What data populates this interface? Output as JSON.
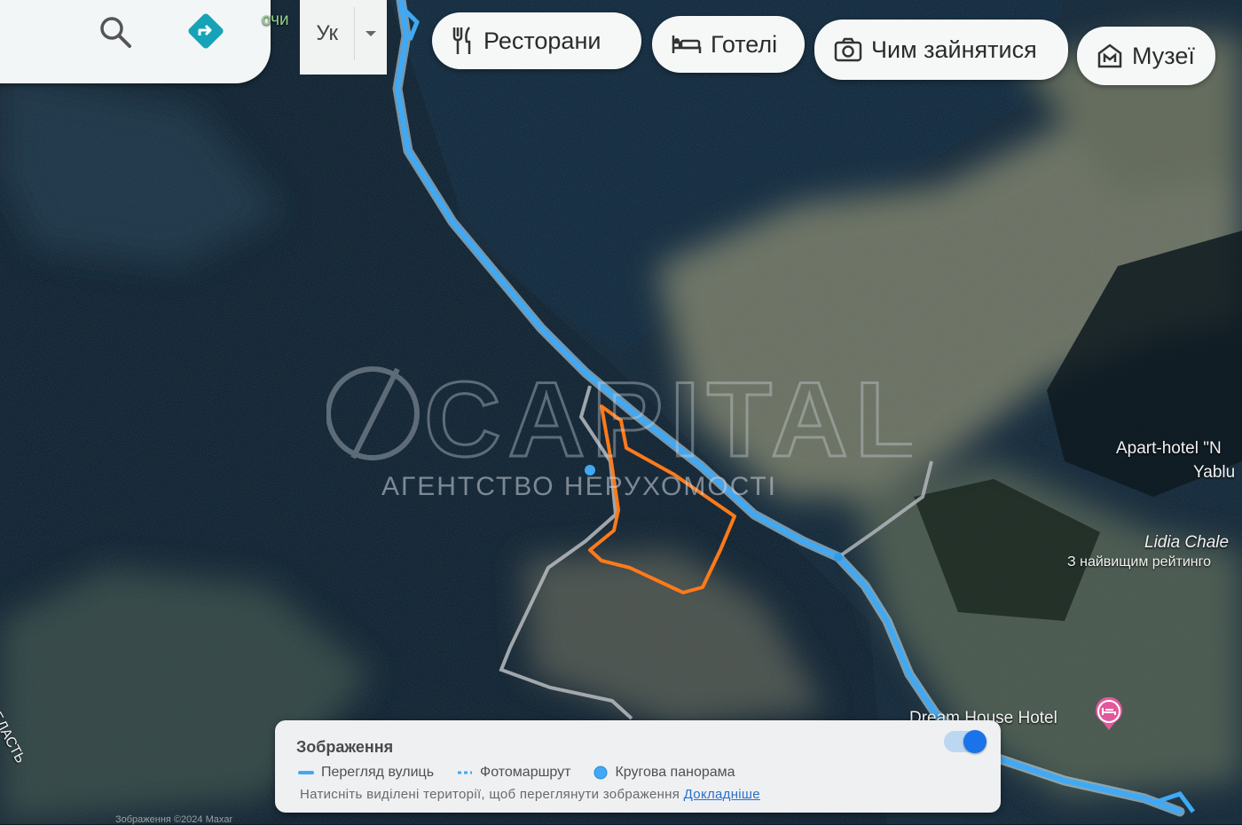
{
  "search": {
    "partial_text": "очи"
  },
  "language": {
    "code": "Ук"
  },
  "chips": [
    {
      "label": "Ресторани",
      "icon": "restaurant-icon"
    },
    {
      "label": "Готелі",
      "icon": "hotel-bed-icon"
    },
    {
      "label": "Чим зайнятися",
      "icon": "camera-icon"
    },
    {
      "label": "Музеї",
      "icon": "museum-icon"
    }
  ],
  "map_labels": {
    "apart_hotel_line1": "Apart-hotel \"N",
    "apart_hotel_line2": "Yablu",
    "lidia_chalet": "Lidia Chale",
    "lidia_rating": "З найвищим рейтинго",
    "dream_house": "Dream House Hotel",
    "region": "БЛАСТЬ"
  },
  "watermark": {
    "brand": "CAPITAL",
    "subtitle": "АГЕНТСТВО НЕРУХОМОСТІ"
  },
  "imagery_panel": {
    "title": "Зображення",
    "legend": [
      {
        "label": "Перегляд вулиць",
        "icon": "street-view-line-icon"
      },
      {
        "label": "Фотомаршрут",
        "icon": "photo-route-dashed-icon"
      },
      {
        "label": "Кругова панорама",
        "icon": "panorama-dot-icon"
      }
    ],
    "hint": "Натисніть виділені території, щоб переглянути зображення",
    "more_link": "Докладніше",
    "toggle_on": true
  },
  "footer": {
    "text": "Зображення ©2024 Maxar"
  },
  "colors": {
    "street_view": "#3fa9f5",
    "parcel_outline": "#ff7a1a",
    "forest": "#0d1d2a",
    "meadow": "#8f8a6a",
    "panel_bg": "#eef0f1",
    "accent": "#1a73e8"
  }
}
